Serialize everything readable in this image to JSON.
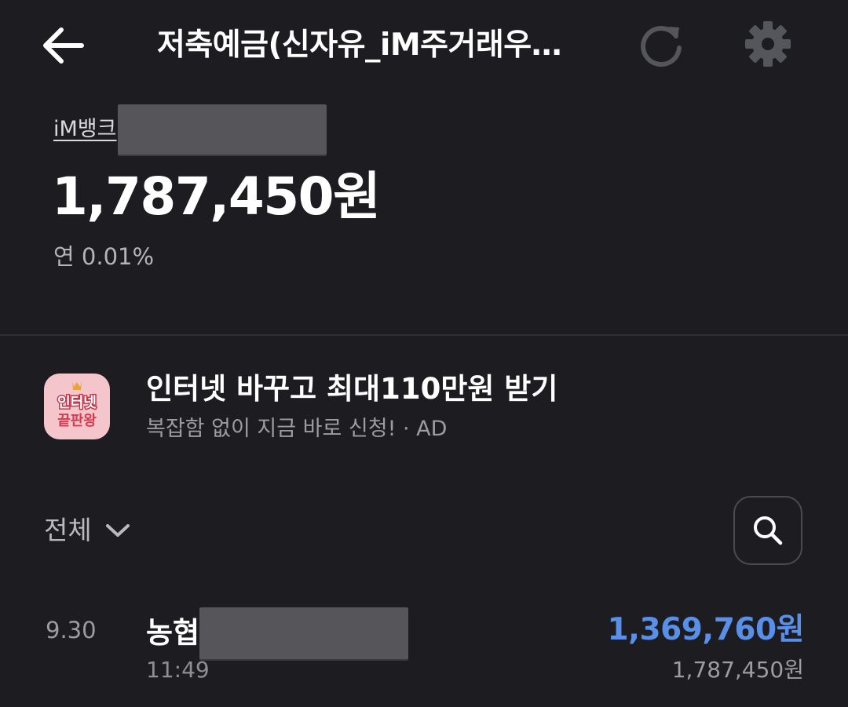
{
  "header": {
    "title": "저축예금(신자유_iM주거래우…"
  },
  "account": {
    "bank_name": "iM뱅크",
    "balance": "1,787,450원",
    "interest_rate": "연 0.01%"
  },
  "ad": {
    "title": "인터넷 바꾸고 최대110만원 받기",
    "subtitle": "복잡함 없이 지금 바로 신청! · AD",
    "icon_text_line1": "인터넷",
    "icon_text_line2": "끝판왕"
  },
  "filter": {
    "selected": "전체"
  },
  "transactions": [
    {
      "date": "9.30",
      "name": "농협",
      "time": "11:49",
      "amount": "1,369,760원",
      "balance_after": "1,787,450원"
    }
  ],
  "colors": {
    "background": "#1c1c21",
    "deposit_amount": "#5a8fe8",
    "ad_icon_bg": "#f4c6cc"
  }
}
